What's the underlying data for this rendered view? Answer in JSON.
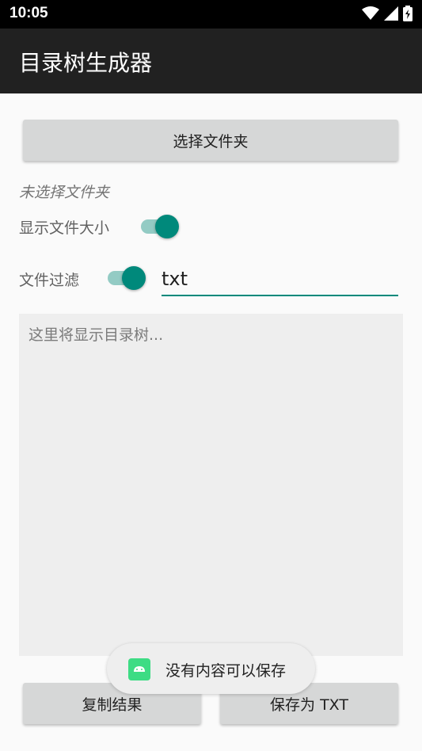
{
  "status_bar": {
    "time": "10:05",
    "icons": [
      "wifi-icon",
      "signal-icon",
      "battery-charging-icon"
    ]
  },
  "app_bar": {
    "title": "目录树生成器"
  },
  "buttons": {
    "select_folder": "选择文件夹",
    "copy_result": "复制结果",
    "save_txt": "保存为 TXT"
  },
  "folder_status": "未选择文件夹",
  "options": {
    "show_size_label": "显示文件大小",
    "show_size_on": true,
    "filter_label": "文件过滤",
    "filter_on": true,
    "filter_value": "txt"
  },
  "tree": {
    "placeholder": "这里将显示目录树..."
  },
  "toast": {
    "message": "没有内容可以保存"
  },
  "colors": {
    "accent": "#00897b",
    "toolbar": "#212121",
    "status_bar": "#000000"
  }
}
